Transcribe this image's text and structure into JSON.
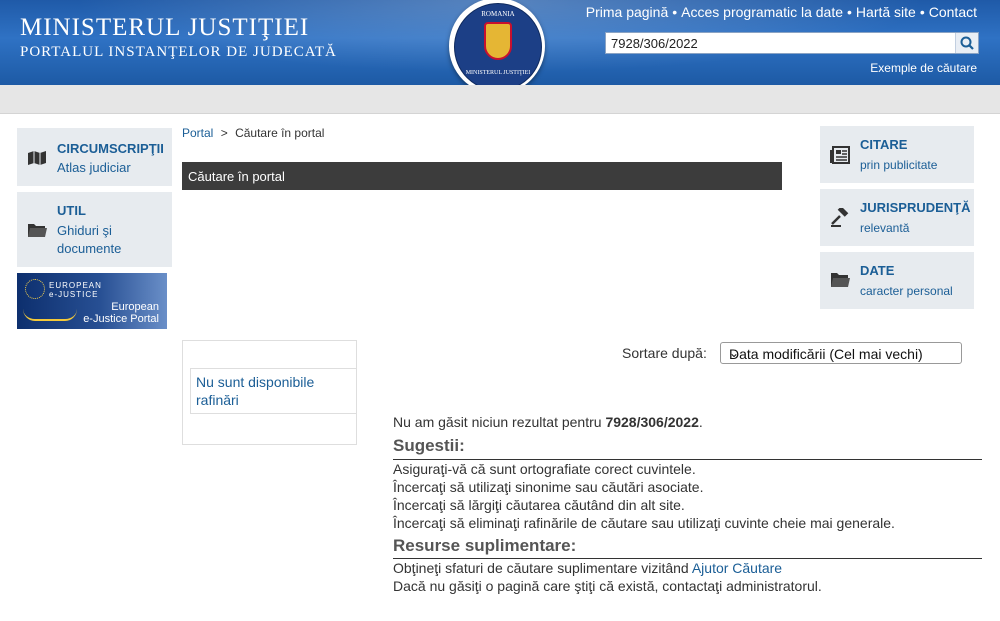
{
  "header": {
    "title": "MINISTERUL JUSTIŢIEI",
    "subtitle": "PORTALUL INSTANŢELOR DE JUDECATĂ",
    "seal_top": "ROMANIA",
    "seal_bottom": "MINISTERUL JUSTIŢIEI",
    "nav": [
      "Prima pagină",
      "Acces programatic la date",
      "Hartă site",
      "Contact"
    ],
    "search_value": "7928/306/2022",
    "examples_link": "Exemple de căutare"
  },
  "left_sidebar": {
    "items": [
      {
        "title": "CIRCUMSCRIPŢII",
        "sub": "Atlas judiciar",
        "icon": "map-icon"
      },
      {
        "title": "UTIL",
        "sub_lines": [
          "Ghiduri şi",
          "documente"
        ],
        "icon": "folder-icon"
      }
    ],
    "ejustice": {
      "top_lines": [
        "EUROPEAN",
        "e-JUSTICE"
      ],
      "bottom_lines": [
        "European",
        "e-Justice Portal"
      ]
    }
  },
  "breadcrumb": {
    "home": "Portal",
    "separator": ">",
    "current": "Căutare în portal"
  },
  "page_title": "Căutare în portal",
  "refinements": {
    "text_lines": [
      "Nu sunt disponibile",
      "rafinări"
    ]
  },
  "sort": {
    "label": "Sortare după:",
    "selected": "Data modificării (Cel mai vechi)"
  },
  "results": {
    "no_result_prefix": "Nu am găsit niciun rezultat pentru ",
    "query": "7928/306/2022",
    "no_result_suffix": ".",
    "suggestions_title": "Sugestii:",
    "suggestions": [
      "Asiguraţi-vă că sunt ortografiate corect cuvintele.",
      "Încercaţi să utilizaţi sinonime sau căutări asociate.",
      "Încercaţi să lărgiţi căutarea căutând din alt site.",
      "Încercaţi să eliminaţi rafinările de căutare sau utilizaţi cuvinte cheie mai generale."
    ],
    "resources_title": "Resurse suplimentare:",
    "resource_line1_prefix": "Obţineţi sfaturi de căutare suplimentare vizitând ",
    "resource_line1_link": "Ajutor Căutare",
    "resource_line2": "Dacă nu găsiţi o pagină care ştiţi că există, contactaţi administratorul."
  },
  "right_sidebar": {
    "items": [
      {
        "title": "CITARE",
        "sub": "prin publicitate",
        "icon": "newspaper-icon"
      },
      {
        "title": "JURISPRUDENŢĂ",
        "sub": "relevantă",
        "icon": "gavel-icon"
      },
      {
        "title": "DATE",
        "sub": "caracter personal",
        "icon": "folder-icon"
      }
    ]
  },
  "colors": {
    "header_blue": "#2f72c4",
    "link_blue": "#1b5e96",
    "panel_gray": "#e7ebef",
    "title_bar": "#3c3c3c"
  }
}
